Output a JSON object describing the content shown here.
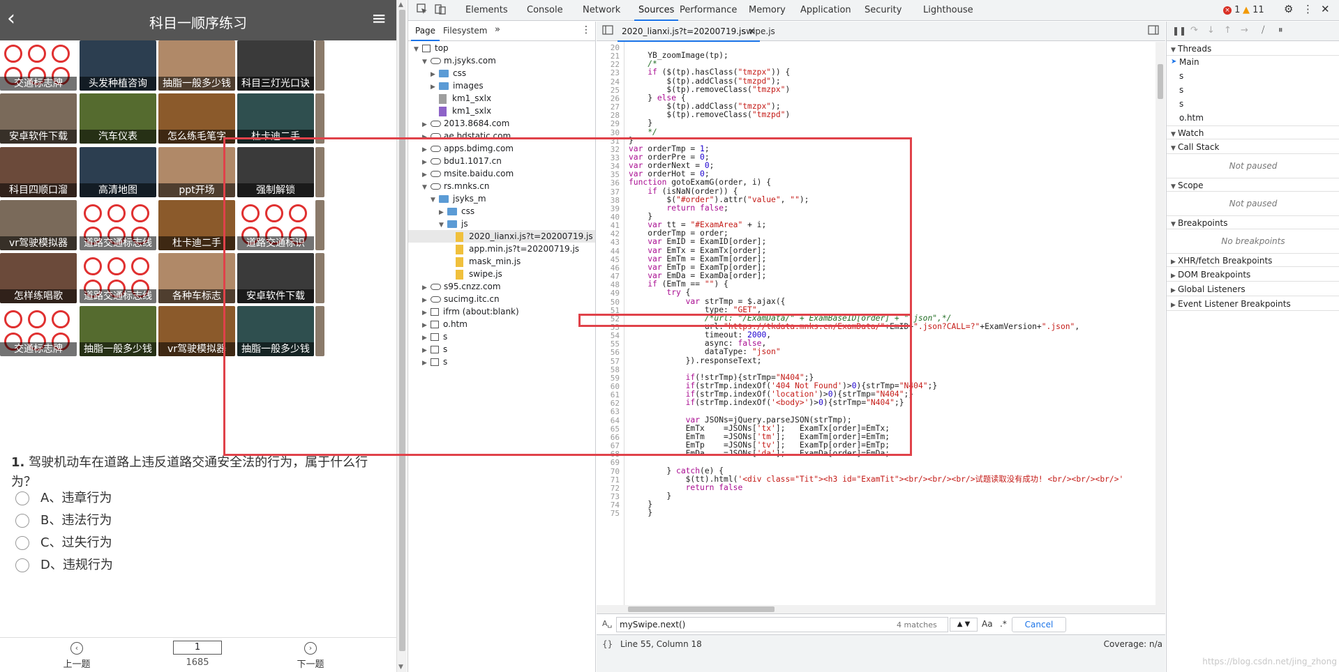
{
  "mobile": {
    "title": "科目一顺序练习",
    "back_glyph": "‹",
    "menu_glyph": "≡",
    "tiles": [
      [
        "交通标志牌",
        "头发种植咨询",
        "抽脂一般多少钱",
        "科目三灯光口诀"
      ],
      [
        "安卓软件下载",
        "汽车仪表",
        "怎么练毛笔字",
        "杜卡迪二手"
      ],
      [
        "科目四顺口溜",
        "高清地图",
        "ppt开场",
        "强制解锁"
      ],
      [
        "vr驾驶模拟器",
        "道路交通标志线",
        "杜卡迪二手",
        "道路交通标识"
      ],
      [
        "怎样练唱歌",
        "道路交通标志线",
        "各种车标志",
        "安卓软件下载"
      ],
      [
        "交通标志牌",
        "抽脂一般多少钱",
        "vr驾驶模拟器",
        "抽脂一般多少钱"
      ]
    ],
    "question_num": "1.",
    "question": "驾驶机动车在道路上违反道路交通安全法的行为，属于什么行为？",
    "options": [
      "A、违章行为",
      "B、违法行为",
      "C、过失行为",
      "D、违规行为"
    ],
    "prev_label": "上一题",
    "next_label": "下一题",
    "page_input": "1",
    "page_total": "1685"
  },
  "devtools": {
    "tabs": [
      "Elements",
      "Console",
      "Network",
      "Sources",
      "Performance",
      "Memory",
      "Application",
      "Security",
      "Lighthouse"
    ],
    "active_tab": "Sources",
    "errors": "1",
    "warnings": "11",
    "nav_tabs": [
      "Page",
      "Filesystem"
    ],
    "tree": [
      {
        "label": "top",
        "kind": "frame",
        "depth": 0,
        "open": true
      },
      {
        "label": "m.jsyks.com",
        "kind": "cloud",
        "depth": 1,
        "open": true
      },
      {
        "label": "css",
        "kind": "folder",
        "depth": 2,
        "open": false
      },
      {
        "label": "images",
        "kind": "folder",
        "depth": 2,
        "open": false
      },
      {
        "label": "km1_sxlx",
        "kind": "file-gray",
        "depth": 2
      },
      {
        "label": "km1_sxlx",
        "kind": "file-purple",
        "depth": 2
      },
      {
        "label": "2013.8684.com",
        "kind": "cloud",
        "depth": 1,
        "open": false
      },
      {
        "label": "ae.bdstatic.com",
        "kind": "cloud",
        "depth": 1,
        "open": false
      },
      {
        "label": "apps.bdimg.com",
        "kind": "cloud",
        "depth": 1,
        "open": false
      },
      {
        "label": "bdu1.1017.cn",
        "kind": "cloud",
        "depth": 1,
        "open": false
      },
      {
        "label": "msite.baidu.com",
        "kind": "cloud",
        "depth": 1,
        "open": false
      },
      {
        "label": "rs.mnks.cn",
        "kind": "cloud",
        "depth": 1,
        "open": true
      },
      {
        "label": "jsyks_m",
        "kind": "folder",
        "depth": 2,
        "open": true
      },
      {
        "label": "css",
        "kind": "folder",
        "depth": 3,
        "open": false
      },
      {
        "label": "js",
        "kind": "folder",
        "depth": 3,
        "open": true
      },
      {
        "label": "2020_lianxi.js?t=20200719.js",
        "kind": "file-yellow",
        "depth": 4,
        "selected": true
      },
      {
        "label": "app.min.js?t=20200719.js",
        "kind": "file-yellow",
        "depth": 4
      },
      {
        "label": "mask_min.js",
        "kind": "file-yellow",
        "depth": 4
      },
      {
        "label": "swipe.js",
        "kind": "file-yellow",
        "depth": 4
      },
      {
        "label": "s95.cnzz.com",
        "kind": "cloud",
        "depth": 1,
        "open": false
      },
      {
        "label": "sucimg.itc.cn",
        "kind": "cloud",
        "depth": 1,
        "open": false
      },
      {
        "label": "ifrm (about:blank)",
        "kind": "frame",
        "depth": 1,
        "open": false
      },
      {
        "label": "o.htm",
        "kind": "frame",
        "depth": 1,
        "open": false
      },
      {
        "label": "s",
        "kind": "frame",
        "depth": 1,
        "open": false
      },
      {
        "label": "s",
        "kind": "frame",
        "depth": 1,
        "open": false
      },
      {
        "label": "s",
        "kind": "frame",
        "depth": 1,
        "open": false
      }
    ],
    "editor_tabs": [
      "2020_lianxi.js?t=20200719.js",
      "swipe.js"
    ],
    "code_lines": [
      {
        "n": "20",
        "t": ""
      },
      {
        "n": "21",
        "t": "    YB_zoomImage(tp);"
      },
      {
        "n": "22",
        "t": "    /*"
      },
      {
        "n": "23",
        "t": "    if ($(tp).hasClass(\"tmzpx\")) {"
      },
      {
        "n": "24",
        "t": "        $(tp).addClass(\"tmzpd\");"
      },
      {
        "n": "25",
        "t": "        $(tp).removeClass(\"tmzpx\")"
      },
      {
        "n": "26",
        "t": "    } else {"
      },
      {
        "n": "27",
        "t": "        $(tp).addClass(\"tmzpx\");"
      },
      {
        "n": "28",
        "t": "        $(tp).removeClass(\"tmzpd\")"
      },
      {
        "n": "29",
        "t": "    }"
      },
      {
        "n": "30",
        "t": "    */"
      },
      {
        "n": "31",
        "t": "}"
      },
      {
        "n": "32",
        "t": "var orderTmp = 1;"
      },
      {
        "n": "33",
        "t": "var orderPre = 0;"
      },
      {
        "n": "34",
        "t": "var orderNext = 0;"
      },
      {
        "n": "35",
        "t": "var orderHot = 0;"
      },
      {
        "n": "36",
        "t": "function gotoExamG(order, i) {"
      },
      {
        "n": "37",
        "t": "    if (isNaN(order)) {"
      },
      {
        "n": "38",
        "t": "        $(\"#order\").attr(\"value\", \"\");"
      },
      {
        "n": "39",
        "t": "        return false;"
      },
      {
        "n": "40",
        "t": "    }"
      },
      {
        "n": "41",
        "t": "    var tt = \"#ExamArea\" + i;"
      },
      {
        "n": "42",
        "t": "    orderTmp = order;"
      },
      {
        "n": "43",
        "t": "    var EmID = ExamID[order];"
      },
      {
        "n": "44",
        "t": "    var EmTx = ExamTx[order];"
      },
      {
        "n": "45",
        "t": "    var EmTm = ExamTm[order];"
      },
      {
        "n": "46",
        "t": "    var EmTp = ExamTp[order];"
      },
      {
        "n": "47",
        "t": "    var EmDa = ExamDa[order];"
      },
      {
        "n": "48",
        "t": "    if (EmTm == \"\") {"
      },
      {
        "n": "49",
        "t": "        try {"
      },
      {
        "n": "50",
        "t": "            var strTmp = $.ajax({"
      },
      {
        "n": "51",
        "t": "                type: \"GET\","
      },
      {
        "n": "52",
        "t": "                /*url: \"/ExamData/\" + ExamBaseID[order] + \".json\",*/"
      },
      {
        "n": "53",
        "t": "                url:\"https://tkdata.mnks.cn/ExamData/\"+EmID+\".json?CALL=?\"+ExamVersion+\".json\","
      },
      {
        "n": "54",
        "t": "                timeout: 2000,"
      },
      {
        "n": "55",
        "t": "                async: false,"
      },
      {
        "n": "56",
        "t": "                dataType: \"json\""
      },
      {
        "n": "57",
        "t": "            }).responseText;"
      },
      {
        "n": "58",
        "t": ""
      },
      {
        "n": "59",
        "t": "            if(!strTmp){strTmp=\"N404\";}"
      },
      {
        "n": "60",
        "t": "            if(strTmp.indexOf('404 Not Found')>0){strTmp=\"N404\";}"
      },
      {
        "n": "61",
        "t": "            if(strTmp.indexOf('location')>0){strTmp=\"N404\";}"
      },
      {
        "n": "62",
        "t": "            if(strTmp.indexOf('<body>')>0){strTmp=\"N404\";}"
      },
      {
        "n": "63",
        "t": ""
      },
      {
        "n": "64",
        "t": "            var JSONs=jQuery.parseJSON(strTmp);"
      },
      {
        "n": "65",
        "t": "            EmTx    =JSONs['tx'];   ExamTx[order]=EmTx;"
      },
      {
        "n": "66",
        "t": "            EmTm    =JSONs['tm'];   ExamTm[order]=EmTm;"
      },
      {
        "n": "67",
        "t": "            EmTp    =JSONs['tv'];   ExamTp[order]=EmTp;"
      },
      {
        "n": "68",
        "t": "            EmDa    =JSONs['da'];   ExamDa[order]=EmDa;"
      },
      {
        "n": "69",
        "t": ""
      },
      {
        "n": "70",
        "t": "        } catch(e) {"
      },
      {
        "n": "71",
        "t": "            $(tt).html('<div class=\"Tit\"><h3 id=\"ExamTit\"><br/><br/><br/>试题读取没有成功! <br/><br/><br/>'"
      },
      {
        "n": "72",
        "t": "            return false"
      },
      {
        "n": "73",
        "t": "        }"
      },
      {
        "n": "74",
        "t": "    }"
      },
      {
        "n": "75",
        "t": "    }"
      }
    ],
    "search_value": "mySwipe.next()",
    "search_matches": "4 matches",
    "search_case": "Aa",
    "search_regex": ".*",
    "search_cancel": "Cancel",
    "status_pos": "Line 55, Column 18",
    "status_coverage": "Coverage: n/a",
    "watermark": "https://blog.csdn.net/jing_zhong",
    "debugger": {
      "threads_label": "Threads",
      "threads": [
        "Main",
        "s",
        "s",
        "s",
        "o.htm"
      ],
      "watch_label": "Watch",
      "callstack_label": "Call Stack",
      "callstack_empty": "Not paused",
      "scope_label": "Scope",
      "scope_empty": "Not paused",
      "breakpoints_label": "Breakpoints",
      "breakpoints_empty": "No breakpoints",
      "xhr_label": "XHR/fetch Breakpoints",
      "dom_label": "DOM Breakpoints",
      "global_label": "Global Listeners",
      "event_label": "Event Listener Breakpoints"
    }
  }
}
